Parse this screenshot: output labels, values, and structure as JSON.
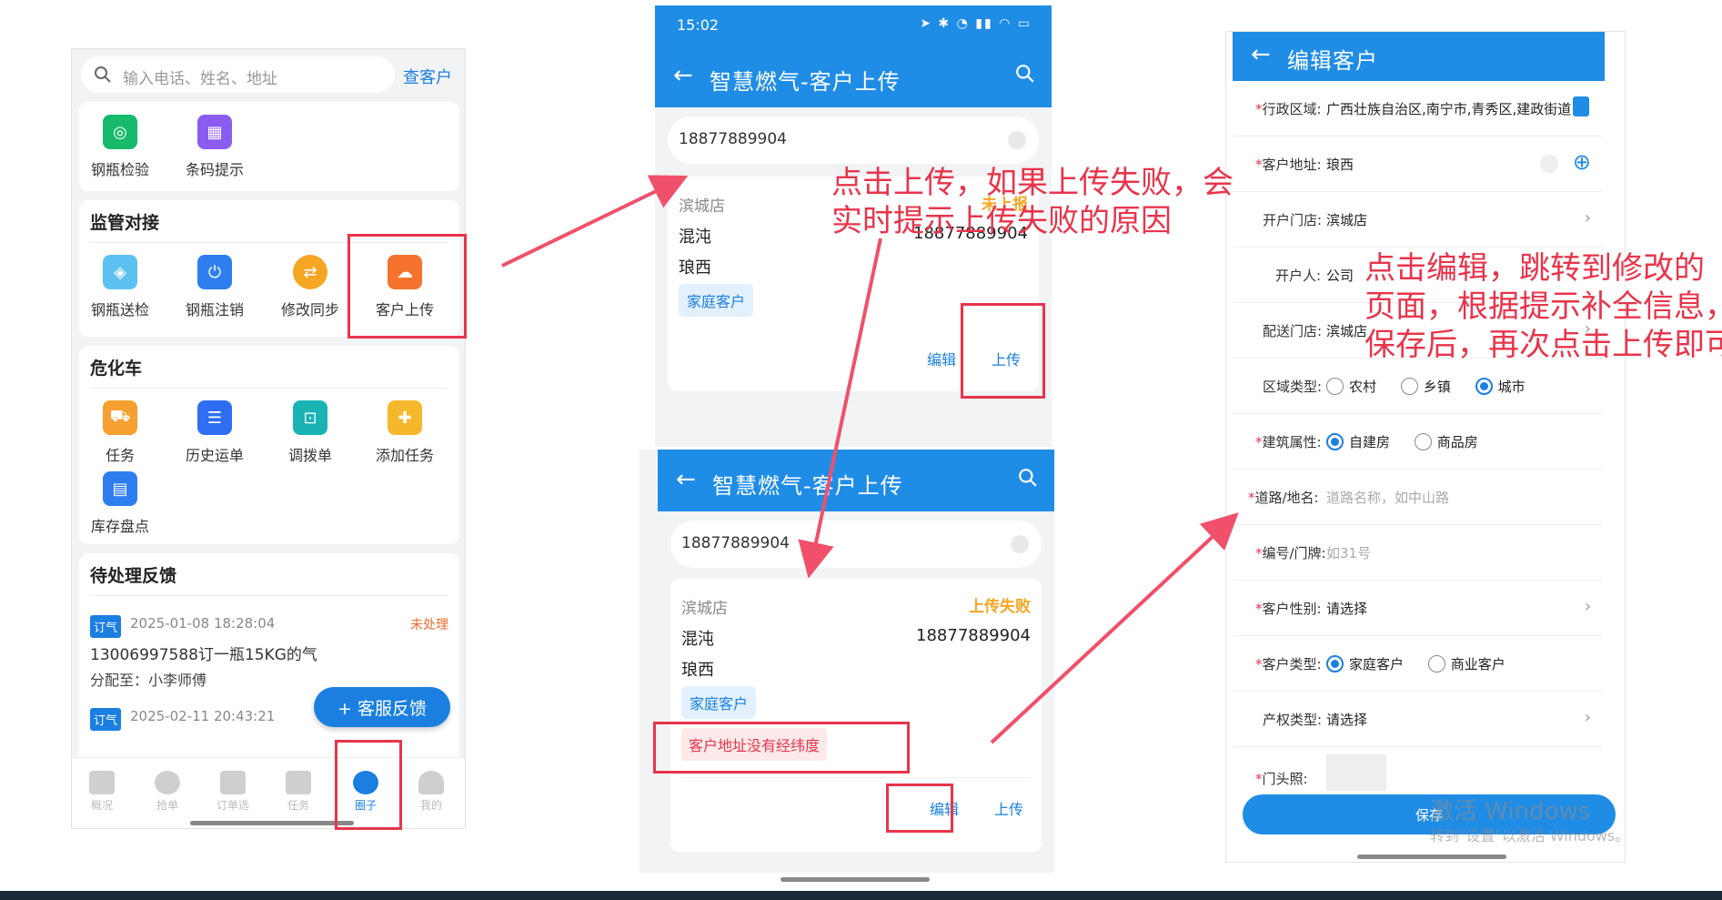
{
  "phone1": {
    "search_placeholder": "输入电话、姓名、地址",
    "search_link": "查客户",
    "top_tiles": [
      {
        "label": "钢瓶检验",
        "color": "#17b96b"
      },
      {
        "label": "条码提示",
        "color": "#8a5cf0"
      }
    ],
    "supervision": {
      "title": "监管对接",
      "tiles": [
        {
          "label": "钢瓶送检",
          "color": "#5cc0f0"
        },
        {
          "label": "钢瓶注销",
          "color": "#2f7ef0"
        },
        {
          "label": "修改同步",
          "color": "#f5a623"
        },
        {
          "label": "客户上传",
          "color": "#f5732d"
        }
      ]
    },
    "hazmat": {
      "title": "危化车",
      "tiles": [
        {
          "label": "任务",
          "color": "#f5a030"
        },
        {
          "label": "历史运单",
          "color": "#2f6ef0"
        },
        {
          "label": "调拨单",
          "color": "#1ab3b3"
        },
        {
          "label": "添加任务",
          "color": "#f5b82d"
        },
        {
          "label": "库存盘点",
          "color": "#2f7ef0"
        }
      ]
    },
    "feedback": {
      "title": "待处理反馈",
      "items": [
        {
          "tag": "订气",
          "time": "2025-01-08 18:28:04",
          "status": "未处理",
          "text": "13006997588订一瓶15KG的气",
          "sub": "分配至：小李师傅"
        },
        {
          "tag": "订气",
          "time": "2025-02-11 20:43:21",
          "status": "",
          "text": "",
          "sub": ""
        }
      ],
      "fab_label": "+ 客服反馈"
    },
    "tabs": [
      "概况",
      "抢单",
      "订单选",
      "任务",
      "圈子",
      "我的"
    ]
  },
  "phone2": {
    "time": "15:02",
    "title": "智慧燃气-客户上传",
    "phone_value": "18877889904",
    "card": {
      "store": "滨城店",
      "status": "未上报",
      "name": "混沌",
      "phone": "18877889904",
      "address": "琅西",
      "tag": "家庭客户",
      "edit": "编辑",
      "upload": "上传"
    }
  },
  "phone2b": {
    "title": "智慧燃气-客户上传",
    "phone_value": "18877889904",
    "card": {
      "store": "滨城店",
      "status": "上传失败",
      "name": "混沌",
      "phone": "18877889904",
      "address": "琅西",
      "tag": "家庭客户",
      "error": "客户地址没有经纬度",
      "edit": "编辑",
      "upload": "上传"
    }
  },
  "phone3": {
    "title": "编辑客户",
    "fields": [
      {
        "label": "行政区域:",
        "value": "广西壮族自治区,南宁市,青秀区,建政街道",
        "required": true
      },
      {
        "label": "客户地址:",
        "value": "琅西",
        "required": true
      },
      {
        "label": "开户门店:",
        "value": "滨城店",
        "required": false
      },
      {
        "label": "开户人:",
        "value": "公司",
        "required": false
      },
      {
        "label": "配送门店:",
        "value": "滨城店",
        "required": false
      }
    ],
    "area_type": {
      "label": "区域类型:",
      "options": [
        "农村",
        "乡镇",
        "城市"
      ],
      "selected": 2
    },
    "building": {
      "label": "建筑属性:",
      "options": [
        "自建房",
        "商品房"
      ],
      "selected": 0
    },
    "road": {
      "label": "道路/地名:",
      "placeholder": "道路名称，如中山路"
    },
    "number": {
      "label": "编号/门牌:",
      "placeholder": "如31号"
    },
    "gender": {
      "label": "客户性别:",
      "value": "请选择"
    },
    "cust_type": {
      "label": "客户类型:",
      "options": [
        "家庭客户",
        "商业客户"
      ],
      "selected": 0
    },
    "property": {
      "label": "产权类型:",
      "value": "请选择"
    },
    "door_photo": {
      "label": "门头照:"
    },
    "save": "保存",
    "watermark": "激活 Windows",
    "watermark_sub": "转到\"设置\"以激活 Windows。"
  },
  "annotations": {
    "a1": [
      "点击上传，如果上传失败，会",
      "实时提示上传失败的原因"
    ],
    "a2": [
      "点击编辑，跳转到修改的",
      "页面，根据提示补全信息，",
      "保存后，再次点击上传即可"
    ]
  },
  "colors": {
    "primary": "#1f8ce6",
    "annotation": "#e8344b",
    "warn": "#f5a623"
  }
}
